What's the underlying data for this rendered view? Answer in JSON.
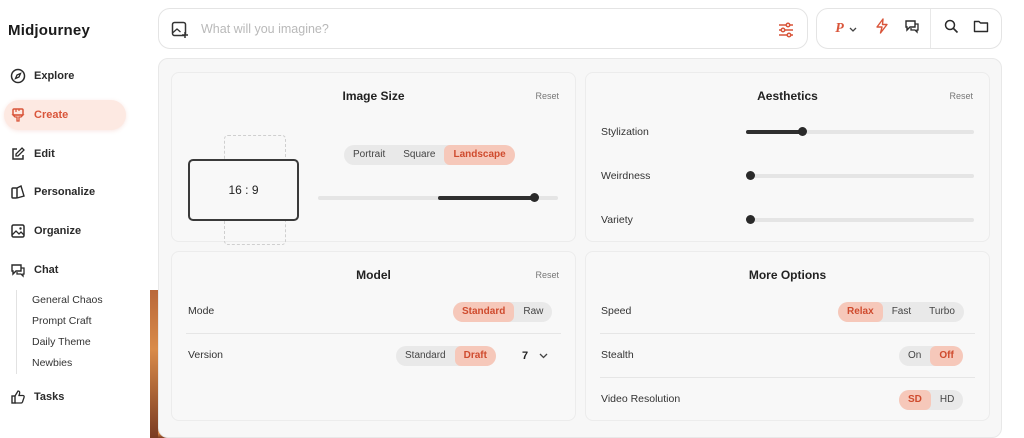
{
  "sidebar": {
    "brand": "Midjourney",
    "items": [
      {
        "label": "Explore",
        "icon": "compass-icon"
      },
      {
        "label": "Create",
        "icon": "brush-icon"
      },
      {
        "label": "Edit",
        "icon": "edit-icon"
      },
      {
        "label": "Personalize",
        "icon": "personalize-icon"
      },
      {
        "label": "Organize",
        "icon": "image-icon"
      },
      {
        "label": "Chat",
        "icon": "chat-icon"
      },
      {
        "label": "Tasks",
        "icon": "thumbs-up-icon"
      }
    ],
    "chat_rooms": [
      "General Chaos",
      "Prompt Craft",
      "Daily Theme",
      "Newbies"
    ]
  },
  "search": {
    "placeholder": "What will you imagine?"
  },
  "toolbar": {
    "personalize_letter": "P"
  },
  "accent": "#d9553a",
  "settings": {
    "image_size": {
      "title": "Image Size",
      "reset": "Reset",
      "ratio_label": "16 : 9",
      "orientation": [
        "Portrait",
        "Square",
        "Landscape"
      ],
      "orientation_selected": "Landscape",
      "aspect_slider_level": 0.9
    },
    "aesthetics": {
      "title": "Aesthetics",
      "reset": "Reset",
      "sliders": [
        {
          "label": "Stylization",
          "level": 0.25
        },
        {
          "label": "Weirdness",
          "level": 0.0
        },
        {
          "label": "Variety",
          "level": 0.0
        }
      ]
    },
    "model": {
      "title": "Model",
      "reset": "Reset",
      "mode_label": "Mode",
      "mode_options": [
        "Standard",
        "Raw"
      ],
      "mode_selected": "Standard",
      "version_label": "Version",
      "version_options": [
        "Standard",
        "Draft"
      ],
      "version_selected": "Draft",
      "version_number": "7"
    },
    "more_options": {
      "title": "More Options",
      "speed_label": "Speed",
      "speed_options": [
        "Relax",
        "Fast",
        "Turbo"
      ],
      "speed_selected": "Relax",
      "stealth_label": "Stealth",
      "stealth_options": [
        "On",
        "Off"
      ],
      "stealth_selected": "Off",
      "video_label": "Video Resolution",
      "video_options": [
        "SD",
        "HD"
      ],
      "video_selected": "SD"
    }
  }
}
